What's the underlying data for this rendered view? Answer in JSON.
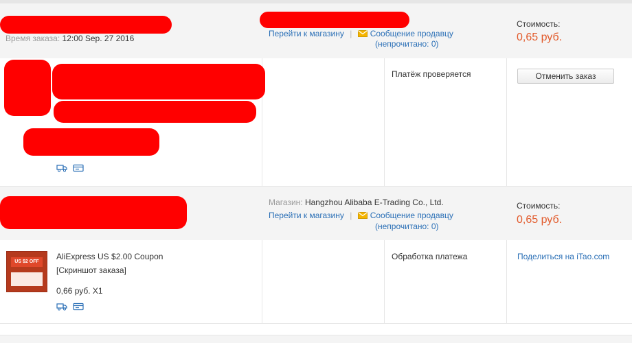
{
  "order1": {
    "time_label": "Время заказа:",
    "time_value": "12:00 Sep. 27 2016",
    "store_link": "Перейти к магазину",
    "separator": "|",
    "message_link": "Сообщение продавцу",
    "unread": "(непрочитано: 0)",
    "price_label": "Стоимость:",
    "price_value": "0,65 руб.",
    "status": "Платёж проверяется",
    "cancel_button": "Отменить заказ"
  },
  "order2": {
    "store_label": "Магазин:",
    "store_name": "Hangzhou Alibaba E-Trading Co., Ltd.",
    "store_link": "Перейти к магазину",
    "separator": "|",
    "message_link": "Сообщение продавцу",
    "unread": "(непрочитано: 0)",
    "price_label": "Стоимость:",
    "price_value": "0,65 руб.",
    "product_title": "AliExpress US $2.00 Coupon",
    "snapshot_link": "[Скриншот заказа]",
    "product_price": "0,66 руб. X1",
    "thumb_badge": "US $2 OFF",
    "status": "Обработка платежа",
    "share_prefix": "Поделиться на ",
    "share_site": "iTao.com"
  },
  "colors": {
    "link": "#2a6fb6",
    "price": "#e25a2b",
    "redaction": "#ff0000",
    "header_bg": "#f4f4f4"
  },
  "icons": [
    "truck-icon",
    "card-icon",
    "envelope-icon"
  ]
}
